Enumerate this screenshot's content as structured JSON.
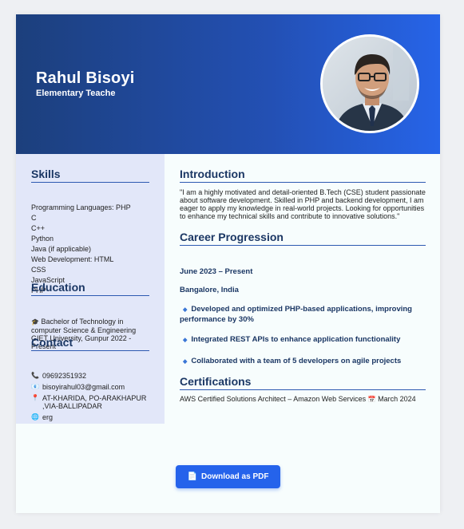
{
  "header": {
    "name": "Rahul Bisoyi",
    "title": "Elementary Teache"
  },
  "skills": {
    "heading": "Skills",
    "items": [
      "Programming Languages: PHP",
      "C",
      "C++",
      "Python",
      "Java (if applicable)",
      "Web Development: HTML",
      "CSS",
      "JavaScript",
      "PHP"
    ]
  },
  "education": {
    "heading": "Education",
    "icon": "graduation-cap-icon",
    "text": "Bachelor of Technology in computer Science & Engineering GIET University, Gunpur 2022 - Present"
  },
  "contact": {
    "heading": "Contact",
    "phone": "09692351932",
    "email": "bisoyirahul03@gmail.com",
    "address": "AT-KHARIDA, PO-ARAKHAPUR ,VIA-BALLIPADAR",
    "website": "erg"
  },
  "introduction": {
    "heading": "Introduction",
    "text": "\"I am a highly motivated and detail-oriented B.Tech (CSE) student passionate about software development. Skilled in PHP and backend development, I am eager to apply my knowledge in real-world projects. Looking for opportunities to enhance my technical skills and contribute to innovative solutions.\""
  },
  "career": {
    "heading": "Career Progression",
    "period": "June 2023 – Present",
    "location": "Bangalore, India",
    "bullets": [
      "Developed and optimized PHP-based applications, improving performance by 30%",
      "Integrated REST APIs to enhance application functionality",
      "Collaborated with a team of 5 developers on agile projects"
    ]
  },
  "certifications": {
    "heading": "Certifications",
    "entry": "AWS Certified Solutions Architect – Amazon Web Services",
    "date": "March 2024"
  },
  "download_button": {
    "label": "Download as PDF",
    "icon": "document-icon"
  },
  "colors": {
    "header_start": "#1c3f7c",
    "header_end": "#2664e8",
    "accent": "#2563eb",
    "heading": "#1b3764",
    "sidebar_bg": "#e2e7f9"
  }
}
